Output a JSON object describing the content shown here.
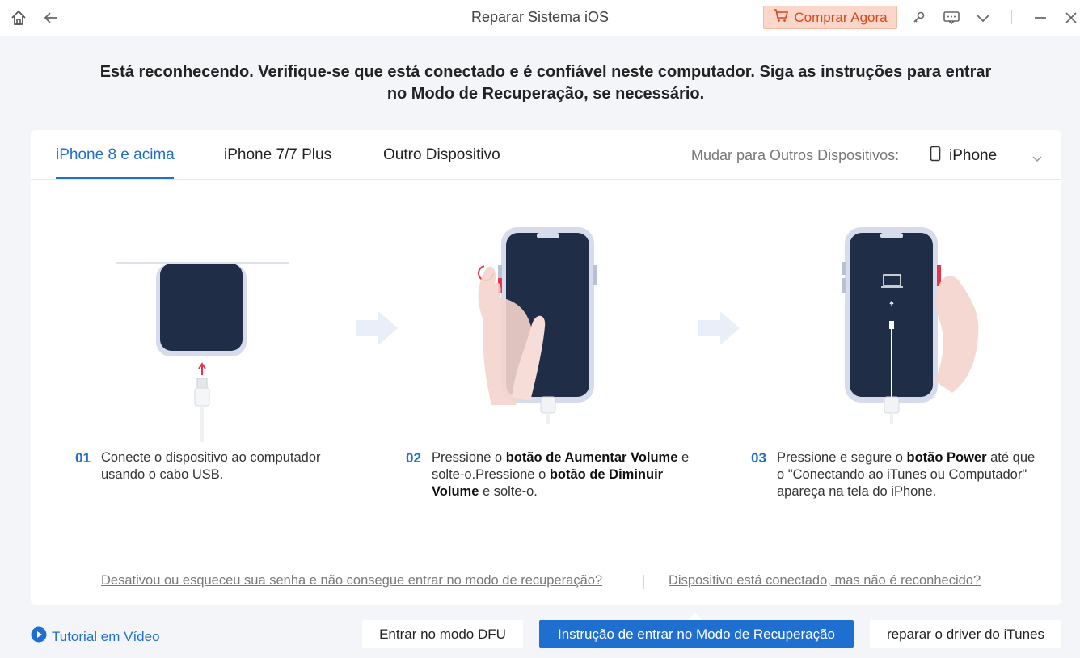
{
  "titlebar": {
    "title": "Reparar Sistema iOS",
    "buy_label": "Comprar Agora",
    "icons": [
      "home-icon",
      "back-arrow-icon",
      "cart-icon",
      "key-icon",
      "feedback-icon",
      "chevron-down-icon",
      "minimize-icon",
      "close-icon"
    ]
  },
  "heading": {
    "line1": "Está reconhecendo. Verifique-se que está conectado e é confiável neste computador. Siga as instruções para entrar",
    "line2": "no Modo de Recuperação, se necessário."
  },
  "tabs": [
    {
      "label": "iPhone 8 e acima",
      "active": true
    },
    {
      "label": "iPhone 7/7 Plus",
      "active": false
    },
    {
      "label": "Outro Dispositivo",
      "active": false
    }
  ],
  "switch": {
    "label": "Mudar para Outros Dispositivos:",
    "selected": "iPhone"
  },
  "steps": [
    {
      "num": "01",
      "parts": [
        {
          "t": "Conecte o dispositivo ao computador usando o cabo USB.",
          "b": false
        }
      ]
    },
    {
      "num": "02",
      "parts": [
        {
          "t": "Pressione o ",
          "b": false
        },
        {
          "t": "botão de Aumentar Volume",
          "b": true
        },
        {
          "t": " e solte-o.Pressione o ",
          "b": false
        },
        {
          "t": "botão de Diminuir Volume",
          "b": true
        },
        {
          "t": " e solte-o.",
          "b": false
        }
      ]
    },
    {
      "num": "03",
      "parts": [
        {
          "t": "Pressione e segure o ",
          "b": false
        },
        {
          "t": "botão Power",
          "b": true
        },
        {
          "t": " até que o \"Conectando ao iTunes ou Computador\" apareça na tela do iPhone.",
          "b": false
        }
      ]
    }
  ],
  "links": {
    "forgot_password": "Desativou ou esqueceu sua senha e não consegue entrar no modo de recuperação?",
    "not_recognized": "Dispositivo está conectado, mas não é reconhecido?"
  },
  "bottom": {
    "tutorial": "Tutorial em Vídeo",
    "dfu_button": "Entrar no modo DFU",
    "recovery_button": "Instrução de entrar no Modo de Recuperação",
    "driver_button": "reparar o driver do iTunes"
  },
  "colors": {
    "accent": "#1f6fd1",
    "buy_bg": "#fbd6c9",
    "buy_text": "#d9461f",
    "phone_screen": "#1f2d46",
    "highlight_button": "#e8334a"
  }
}
